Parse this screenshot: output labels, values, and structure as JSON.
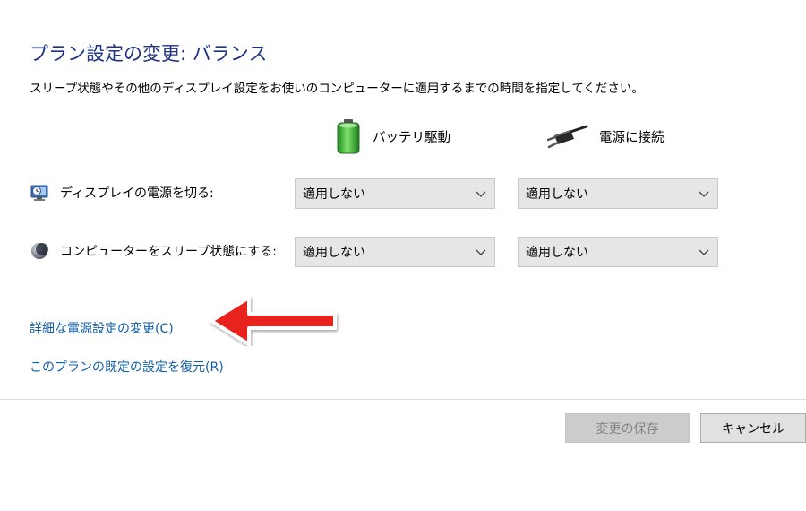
{
  "header": {
    "title": "プラン設定の変更: バランス",
    "description": "スリープ状態やその他のディスプレイ設定をお使いのコンピューターに適用するまでの時間を指定してください。"
  },
  "columns": {
    "battery_label": "バッテリ駆動",
    "plugged_label": "電源に接続"
  },
  "settings": {
    "display_off": {
      "label": "ディスプレイの電源を切る:",
      "battery_value": "適用しない",
      "plugged_value": "適用しない"
    },
    "sleep": {
      "label": "コンピューターをスリープ状態にする:",
      "battery_value": "適用しない",
      "plugged_value": "適用しない"
    }
  },
  "links": {
    "advanced": "詳細な電源設定の変更(C)",
    "restore_defaults": "このプランの既定の設定を復元(R)"
  },
  "buttons": {
    "save": "変更の保存",
    "cancel": "キャンセル"
  },
  "icons": {
    "battery": "battery-icon",
    "plug": "power-plug-icon",
    "display": "display-timer-icon",
    "sleep": "sleep-moon-icon",
    "chevron": "chevron-down-icon",
    "annotation": "red-arrow-annotation"
  },
  "colors": {
    "title": "#1e3287",
    "link": "#0f5fa8",
    "annotation_arrow": "#e8201c"
  }
}
